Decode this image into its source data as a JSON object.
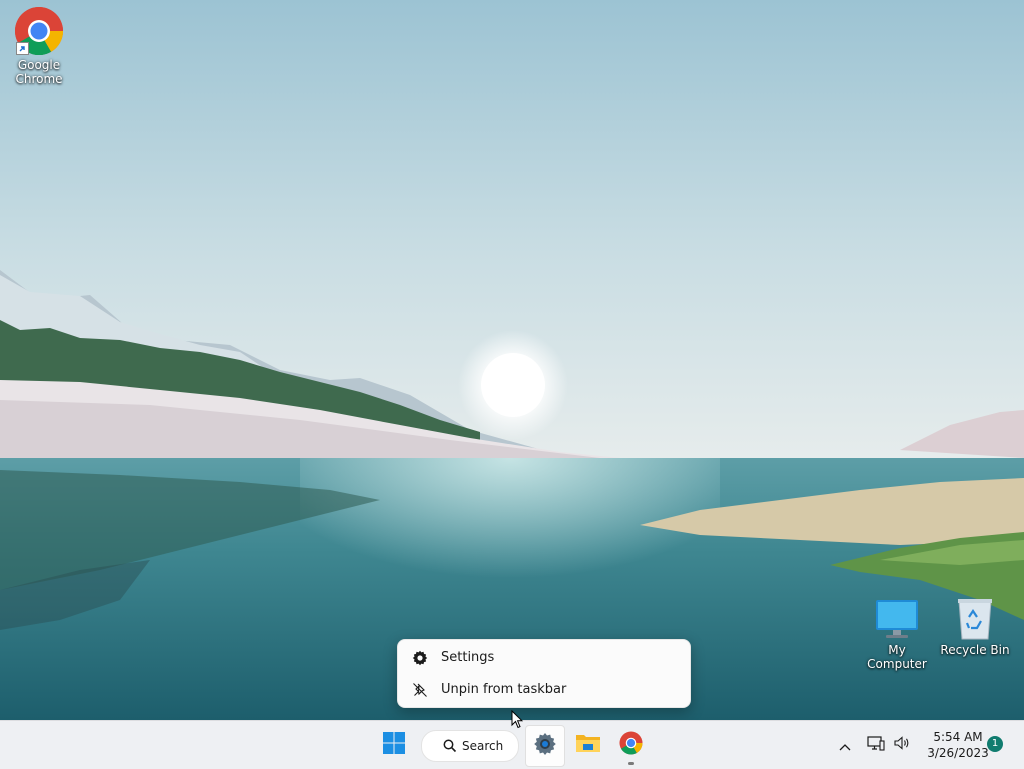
{
  "desktop": {
    "icons": [
      {
        "label": "Google Chrome",
        "icon": "chrome-icon"
      },
      {
        "label": "My Computer",
        "icon": "monitor-icon"
      },
      {
        "label": "Recycle Bin",
        "icon": "recycle-bin-icon"
      }
    ]
  },
  "context_menu": {
    "items": [
      {
        "label": "Settings",
        "icon": "gear-icon"
      },
      {
        "label": "Unpin from taskbar",
        "icon": "unpin-icon"
      }
    ]
  },
  "taskbar": {
    "start": {
      "icon": "windows-start-icon"
    },
    "search": {
      "label": "Search",
      "icon": "search-icon"
    },
    "apps": [
      {
        "name": "Settings",
        "icon": "gear-icon",
        "active": true
      },
      {
        "name": "File Explorer",
        "icon": "folder-icon"
      },
      {
        "name": "Google Chrome",
        "icon": "chrome-icon",
        "running": true
      }
    ],
    "tray": {
      "chevron": "chevron-up-icon",
      "network": "network-icon",
      "volume": "volume-icon"
    },
    "clock": {
      "time": "5:54 AM",
      "date": "3/26/2023"
    },
    "notifications": {
      "count": "1"
    }
  },
  "colors": {
    "accent": "#0067c0",
    "taskbar_bg": "#eef0f3",
    "menu_bg": "#fbfbfb"
  }
}
